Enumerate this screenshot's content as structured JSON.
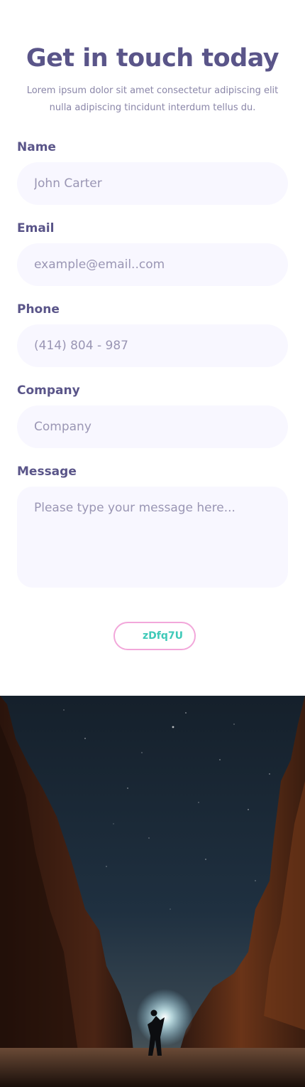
{
  "header": {
    "title": "Get in touch today",
    "subtitle_line1": "Lorem ipsum dolor sit amet consectetur adipiscing elit",
    "subtitle_line2": "nulla adipiscing tincidunt interdum tellus du."
  },
  "form": {
    "name": {
      "label": "Name",
      "placeholder": "John Carter"
    },
    "email": {
      "label": "Email",
      "placeholder": "example@email..com"
    },
    "phone": {
      "label": "Phone",
      "placeholder": "(414) 804 - 987"
    },
    "company": {
      "label": "Company",
      "placeholder": "Company"
    },
    "message": {
      "label": "Message",
      "placeholder": "Please type your message here..."
    }
  },
  "captcha": {
    "code": "zDfq7U"
  },
  "colors": {
    "heading": "#5a5589",
    "input_background": "#f8f7ff",
    "captcha_border": "#f2a7da",
    "captcha_text": "#3ec9b8"
  },
  "photo": {
    "subject": "night-canyon-stargazer-image"
  }
}
